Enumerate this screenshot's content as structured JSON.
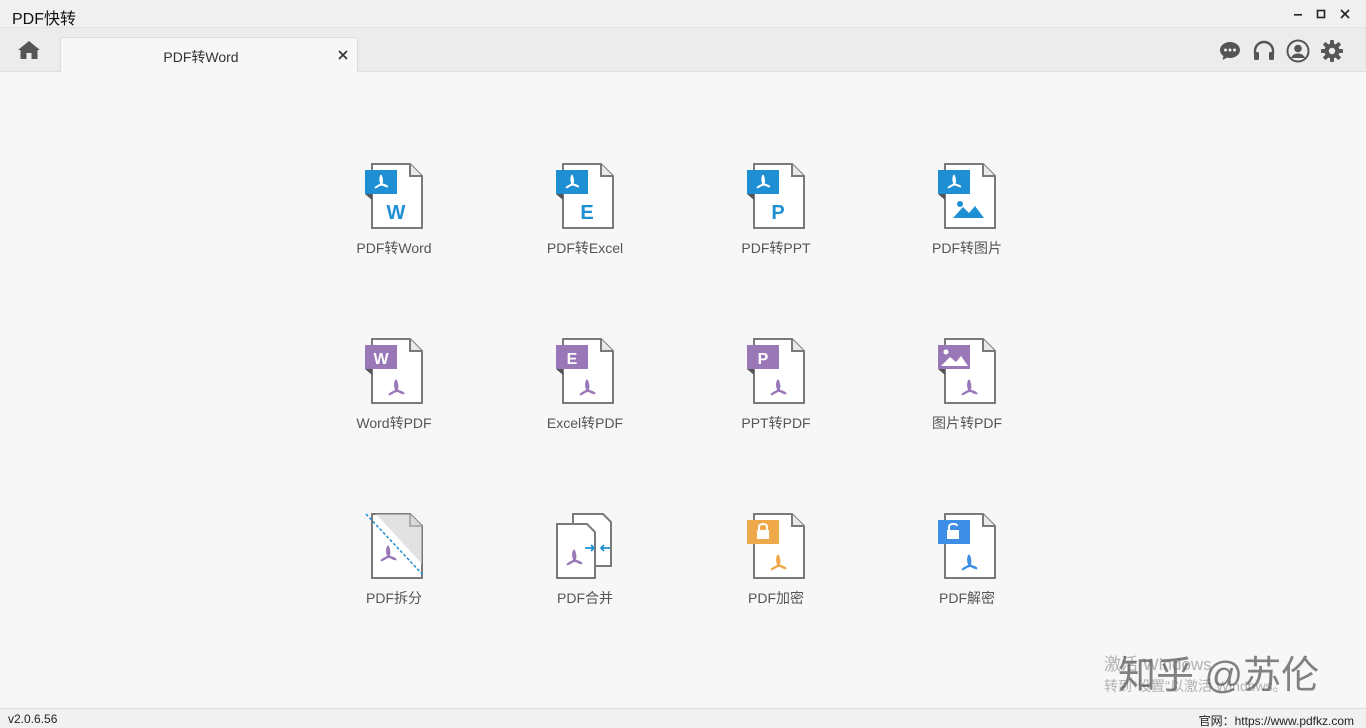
{
  "window": {
    "title": "PDF快转",
    "minimize_icon": "minimize-icon",
    "maximize_icon": "maximize-icon",
    "close_icon": "close-icon"
  },
  "toolbar": {
    "home_icon": "home-icon",
    "tab": {
      "label": "PDF转Word",
      "close_icon": "close-icon"
    },
    "right_icons": [
      "chat-icon",
      "headset-icon",
      "user-icon",
      "gear-icon"
    ]
  },
  "functions": [
    {
      "label": "PDF转Word",
      "icon": "pdf-to-word-icon"
    },
    {
      "label": "PDF转Excel",
      "icon": "pdf-to-excel-icon"
    },
    {
      "label": "PDF转PPT",
      "icon": "pdf-to-ppt-icon"
    },
    {
      "label": "PDF转图片",
      "icon": "pdf-to-image-icon"
    },
    {
      "label": "Word转PDF",
      "icon": "word-to-pdf-icon"
    },
    {
      "label": "Excel转PDF",
      "icon": "excel-to-pdf-icon"
    },
    {
      "label": "PPT转PDF",
      "icon": "ppt-to-pdf-icon"
    },
    {
      "label": "图片转PDF",
      "icon": "image-to-pdf-icon"
    },
    {
      "label": "PDF拆分",
      "icon": "pdf-split-icon"
    },
    {
      "label": "PDF合并",
      "icon": "pdf-merge-icon"
    },
    {
      "label": "PDF加密",
      "icon": "pdf-encrypt-icon"
    },
    {
      "label": "PDF解密",
      "icon": "pdf-decrypt-icon"
    }
  ],
  "watermarks": {
    "activate_line1": "激活 Windows",
    "activate_line2": "转到\"设置\"以激活 Windows。",
    "zhihu": "知乎 @苏伦"
  },
  "statusbar": {
    "version": "v2.0.6.56",
    "website": "官网：https://www.pdfkz.com"
  },
  "colors": {
    "blue": "#1e8fd2",
    "purple": "#9a78b8",
    "orange": "#f0a94a",
    "light_blue": "#3d8ee6",
    "gray": "#888888"
  }
}
